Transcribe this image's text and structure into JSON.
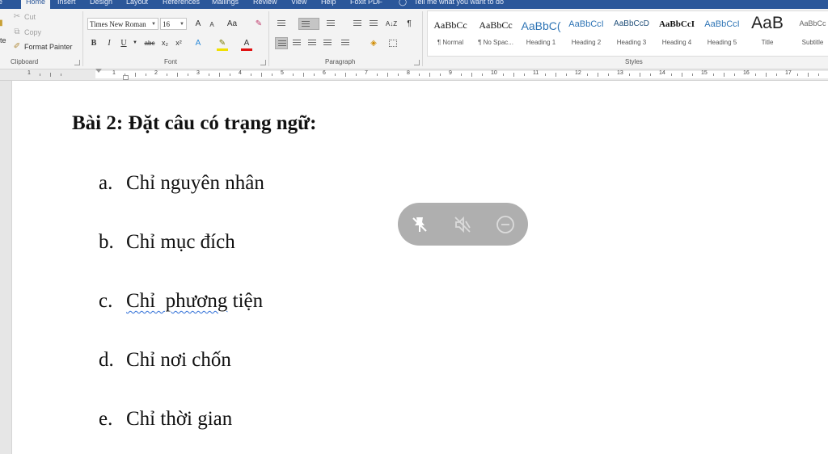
{
  "tabs": [
    "Home",
    "Insert",
    "Design",
    "Layout",
    "References",
    "Mailings",
    "Review",
    "View",
    "Help",
    "Foxit PDF"
  ],
  "tell_me": "Tell me what you want to do",
  "clipboard": {
    "cut": "Cut",
    "copy": "Copy",
    "format_painter": "Format Painter",
    "label": "Clipboard",
    "paste_partial": "te"
  },
  "font": {
    "name": "Times New Roman",
    "size": "16",
    "label": "Font",
    "grow": "A",
    "shrink": "A",
    "change_case": "Aa",
    "bold": "B",
    "italic": "I",
    "underline": "U",
    "strikethrough": "abc",
    "subscript": "x₂",
    "superscript": "x²",
    "font_color_letter": "A",
    "text_effects_letter": "A",
    "highlight_color": "#f0e000",
    "font_color": "#e01010"
  },
  "paragraph": {
    "label": "Paragraph",
    "pilcrow": "¶",
    "sort": "A↓Z"
  },
  "styles": {
    "label": "Styles",
    "items": [
      {
        "preview": "AaBbCc",
        "name": "¶ Normal"
      },
      {
        "preview": "AaBbCc",
        "name": "¶ No Spac..."
      },
      {
        "preview": "AaBbC(",
        "name": "Heading 1"
      },
      {
        "preview": "AaBbCcI",
        "name": "Heading 2"
      },
      {
        "preview": "AaBbCcD",
        "name": "Heading 3"
      },
      {
        "preview": "AaBbCcI",
        "name": "Heading 4"
      },
      {
        "preview": "AaBbCcI",
        "name": "Heading 5"
      },
      {
        "preview": "AaB",
        "name": "Title"
      },
      {
        "preview": "AaBbCc",
        "name": "Subtitle"
      }
    ]
  },
  "ruler": {
    "numbers": [
      "1",
      "1",
      "2",
      "3",
      "4",
      "5",
      "6",
      "7",
      "8",
      "9",
      "10",
      "11",
      "12",
      "13",
      "14",
      "15",
      "16",
      "17"
    ]
  },
  "document": {
    "heading": "Bài 2: Đặt câu có trạng ngữ:",
    "items": [
      {
        "marker": "a.",
        "text": "Chỉ nguyên nhân"
      },
      {
        "marker": "b.",
        "text": "Chỉ mục đích"
      },
      {
        "marker": "c.",
        "text_first": "Chỉ  phương",
        "text_rest": " tiện"
      },
      {
        "marker": "d.",
        "text": "Chỉ nơi chốn"
      },
      {
        "marker": "e.",
        "text": "Chỉ thời gian"
      }
    ]
  },
  "floating_toolbar": {
    "icons": [
      "unpin-icon",
      "mute-icon",
      "minimize-icon"
    ]
  },
  "colors": {
    "title_bar": "#2b579a",
    "ribbon": "#f3f3f3",
    "heading_color": "#2e74b5"
  }
}
